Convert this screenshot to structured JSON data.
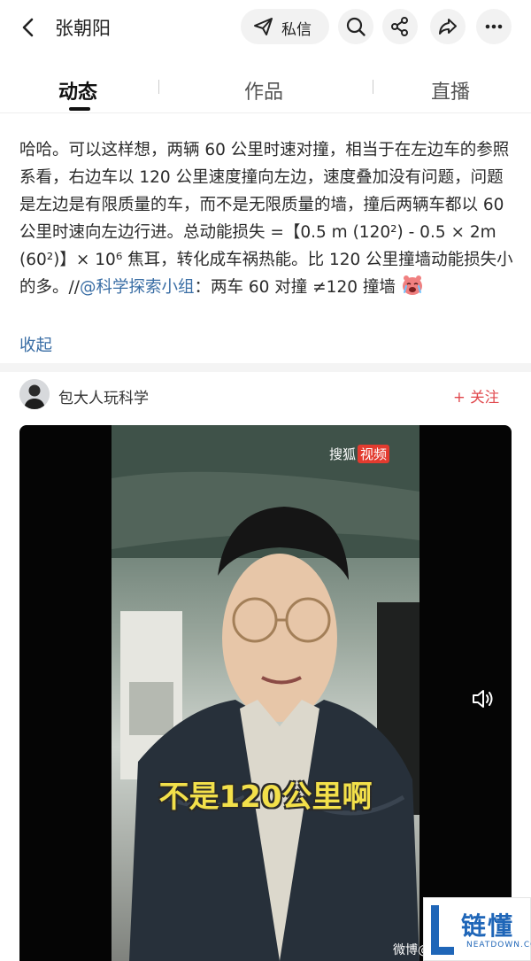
{
  "header": {
    "title": "张朝阳",
    "message_label": "私信",
    "icons": [
      "back-icon",
      "send-message-icon",
      "search-icon",
      "share-network-icon",
      "share-forward-icon",
      "more-icon"
    ]
  },
  "tabs": [
    {
      "label": "动态",
      "active": true
    },
    {
      "label": "作品",
      "active": false
    },
    {
      "label": "直播",
      "active": false
    }
  ],
  "post": {
    "text": "哈哈。可以这样想，两辆 60 公里时速对撞，相当于在左边车的参照系看，右边车以 120 公里速度撞向左边，速度叠加没有问题，问题是左边是有限质量的车，而不是无限质量的墙，撞后两辆车都以 60 公里时速向左边行进。总动能损失 =【0.5 m (120²) - 0.5 × 2m (60²)】× 10⁶ 焦耳，转化成车祸热能。比 120 公里撞墙动能损失小的多。//",
    "mention": "@科学探索小组",
    "suffix": "：两车 60 对撞 ≠120 撞墙",
    "emoji": "crying-face-emoji",
    "collapse_label": "收起"
  },
  "repost": {
    "author": "包大人玩科学",
    "follow_label": "+ 关注"
  },
  "video": {
    "logo_text": "搜狐",
    "logo_badge": "视频",
    "caption": "不是120公里啊",
    "watermark": "微博@",
    "sound_icon": "speaker-icon"
  },
  "brand": {
    "name": "链懂",
    "url": "NEATDOWN.COM"
  },
  "colors": {
    "link": "#3a6ea5",
    "follow": "#e0474c",
    "caption": "#f3e04a",
    "brand": "#1f66b8"
  }
}
